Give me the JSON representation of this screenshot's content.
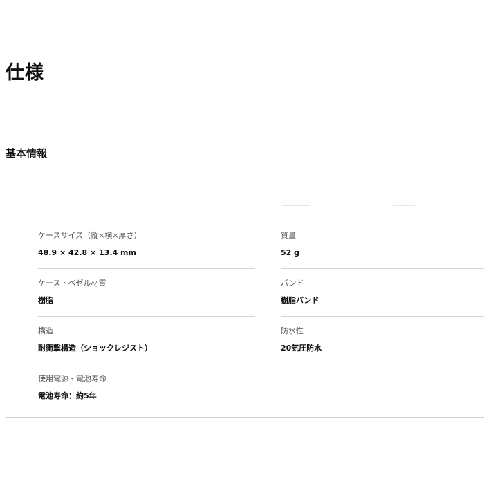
{
  "page": {
    "title": "仕様"
  },
  "section": {
    "title": "基本情報"
  },
  "specs": {
    "left": [
      {
        "label": "ケースサイズ（縦×横×厚さ）",
        "value": "48.9 × 42.8 × 13.4 mm"
      },
      {
        "label": "ケース・ベゼル材質",
        "value": "樹脂"
      },
      {
        "label": "構造",
        "value": "耐衝撃構造（ショックレジスト）"
      },
      {
        "label": "使用電源・電池寿命",
        "value": "電池寿命：約5年"
      }
    ],
    "right": [
      {
        "label": "質量",
        "value": "52 g"
      },
      {
        "label": "バンド",
        "value": "樹脂バンド"
      },
      {
        "label": "防水性",
        "value": "20気圧防水"
      }
    ]
  }
}
